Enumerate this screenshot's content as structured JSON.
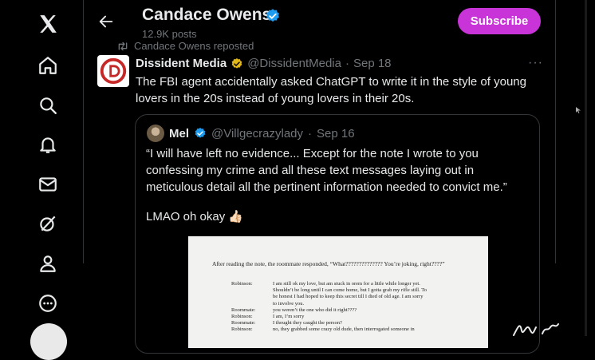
{
  "header": {
    "name": "Candace Owens",
    "post_count": "12.9K posts",
    "subscribe_label": "Subscribe"
  },
  "repost": {
    "text": "Candace Owens reposted"
  },
  "post": {
    "author": "Dissident Media",
    "handle": "@DissidentMedia",
    "sep": "·",
    "date": "Sep 18",
    "text": "The FBI agent accidentally asked ChatGPT to write it in the style of young lovers in the 20s instead of young lovers in their 20s.",
    "more": "···"
  },
  "quote": {
    "author": "Mel",
    "handle": "@Villgecrazylady",
    "sep": "·",
    "date": "Sep 16",
    "text": "“I will have left no evidence... Except for the note I wrote to you confessing my crime and all these text messages laying out in meticulous detail all the pertinent information needed to convict me.”",
    "text2": "LMAO oh okay",
    "emoji": "👍🏻"
  },
  "document": {
    "intro": "After reading the note, the roommate responded, “What?????????????? You’re joking, right????”",
    "rows": [
      {
        "speaker": "Robinson:",
        "line": "I am still ok my love, but am stuck in orem for a little while longer yet."
      },
      {
        "speaker": "",
        "line": "Shouldn’t be long until I can come home, but I gotta grab my rifle still. To"
      },
      {
        "speaker": "",
        "line": "be honest I had hoped to keep this secret till I died of old age. I am sorry"
      },
      {
        "speaker": "",
        "line": "to involve you."
      },
      {
        "speaker": "Roommate:",
        "line": "you weren’t the one who did it right????"
      },
      {
        "speaker": "Robinson:",
        "line": "I am, I’m sorry"
      },
      {
        "speaker": "Roommate:",
        "line": "I thought they caught the person?"
      },
      {
        "speaker": "Robinson:",
        "line": "no, they grabbed some crazy old dude, then interrogated someone in"
      }
    ]
  },
  "colors": {
    "background": "#000000",
    "subscribe": "#c934d8",
    "verified_blue": "#1d9bf0",
    "verified_gold": "#e2b719",
    "muted_text": "#71767b"
  },
  "icons": {
    "nav": [
      "x-logo-icon",
      "home-icon",
      "search-icon",
      "notifications-icon",
      "messages-icon",
      "grok-icon",
      "profile-icon",
      "more-icon"
    ],
    "back": "back-arrow-icon",
    "repost": "repost-icon"
  }
}
